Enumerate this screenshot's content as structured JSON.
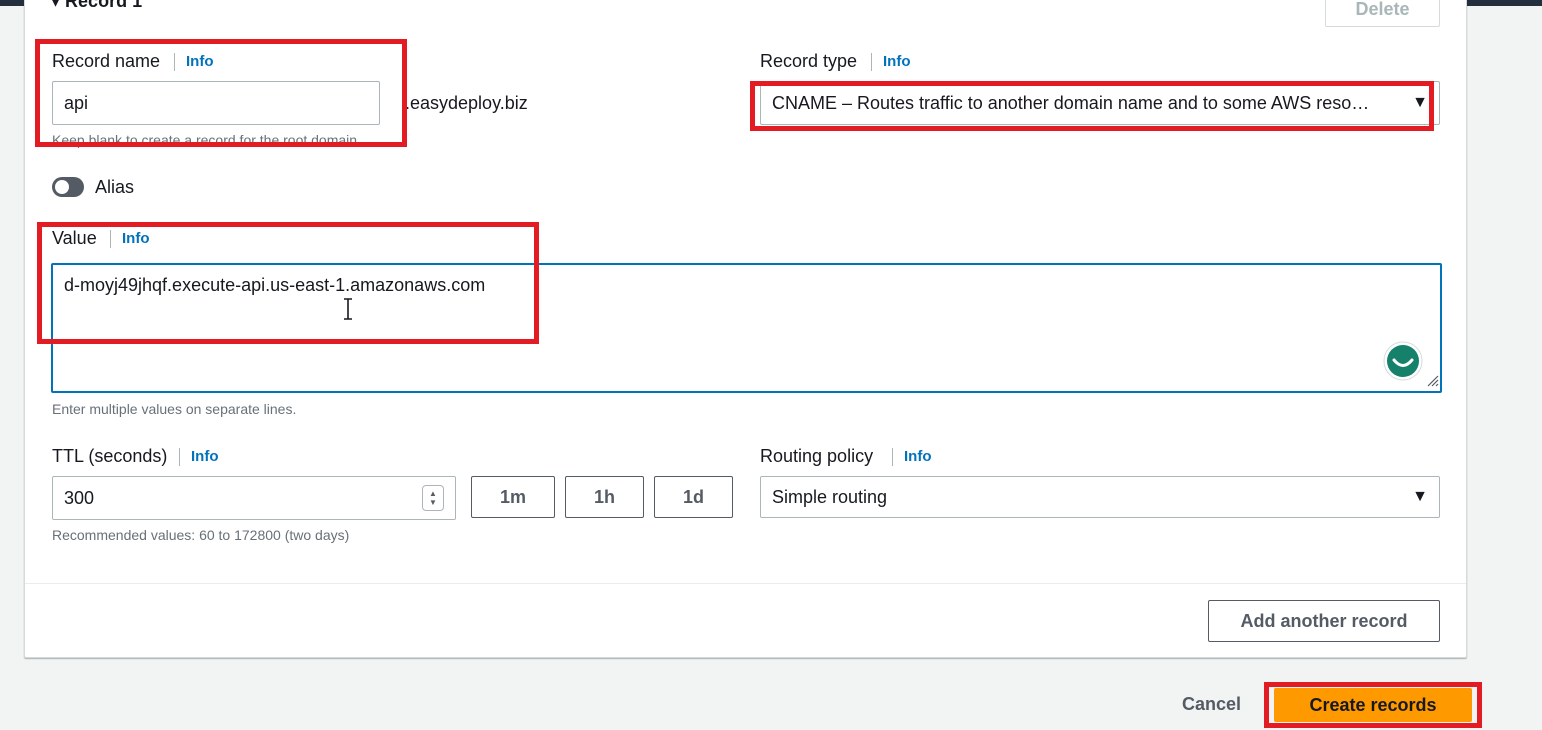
{
  "form": {
    "section_title": "Record 1",
    "delete_label": "Delete",
    "record_name": {
      "label": "Record name",
      "info": "Info",
      "value": "api",
      "suffix": ".easydeploy.biz",
      "hint": "Keep blank to create a record for the root domain."
    },
    "record_type": {
      "label": "Record type",
      "info": "Info",
      "selected": "CNAME – Routes traffic to another domain name and to some AWS reso…"
    },
    "alias": {
      "label": "Alias",
      "enabled": false
    },
    "value": {
      "label": "Value",
      "info": "Info",
      "text": "d-moyj49jhqf.execute-api.us-east-1.amazonaws.com",
      "hint": "Enter multiple values on separate lines."
    },
    "ttl": {
      "label": "TTL (seconds)",
      "info": "Info",
      "value": "300",
      "presets": [
        "1m",
        "1h",
        "1d"
      ],
      "hint": "Recommended values: 60 to 172800 (two days)"
    },
    "routing_policy": {
      "label": "Routing policy",
      "info": "Info",
      "selected": "Simple routing"
    },
    "add_another_label": "Add another record"
  },
  "footer": {
    "cancel_label": "Cancel",
    "create_label": "Create records"
  },
  "colors": {
    "highlight": "#e31b23",
    "primary": "#ff9900",
    "link": "#0073bb",
    "focus": "#0073bb"
  },
  "icons": {
    "caret": "caret-down-icon",
    "assistant": "grammar-assistant-icon",
    "resize": "resize-grip-icon",
    "cursor": "text-cursor-icon"
  }
}
